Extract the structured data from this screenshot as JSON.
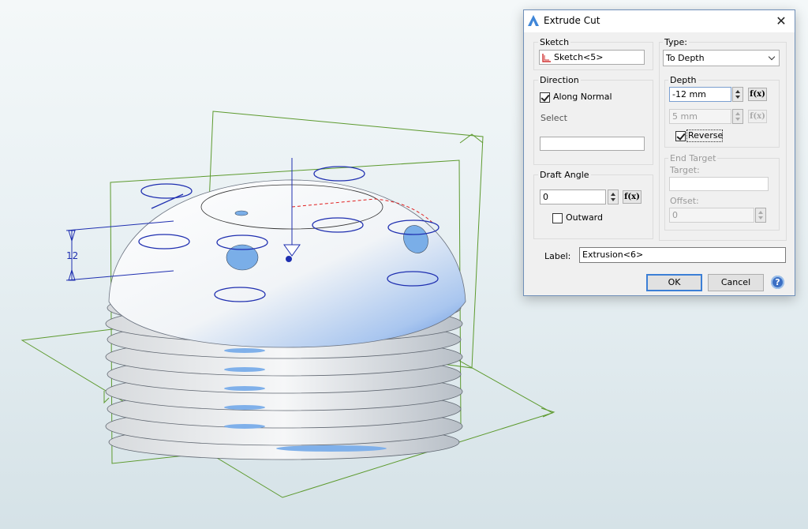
{
  "dialog": {
    "title": "Extrude Cut",
    "sketch": {
      "label": "Sketch",
      "value": "Sketch<5>"
    },
    "direction": {
      "label": "Direction",
      "along_normal": "Along Normal",
      "along_normal_checked": true,
      "select_label": "Select",
      "select_value": ""
    },
    "type": {
      "label": "Type:",
      "value": "To Depth"
    },
    "depth": {
      "label": "Depth",
      "value": "-12 mm",
      "second_value": "5 mm",
      "reverse_label": "Reverse",
      "reverse_checked": true
    },
    "end_target": {
      "label": "End Target",
      "target_label": "Target:",
      "target_value": "",
      "offset_label": "Offset:",
      "offset_value": "0"
    },
    "draft_angle": {
      "label": "Draft Angle",
      "value": "0",
      "outward_label": "Outward",
      "outward_checked": false
    },
    "feature_label": {
      "label": "Label:",
      "value": "Extrusion<6>"
    },
    "fx_label": "f(x)",
    "buttons": {
      "ok": "OK",
      "cancel": "Cancel",
      "help": "?"
    }
  },
  "viewport": {
    "dimension_value": "12",
    "sketch_color": "#1f2fb0",
    "plane_color": "#5d9a2e",
    "part_color": "#eef2f6"
  }
}
